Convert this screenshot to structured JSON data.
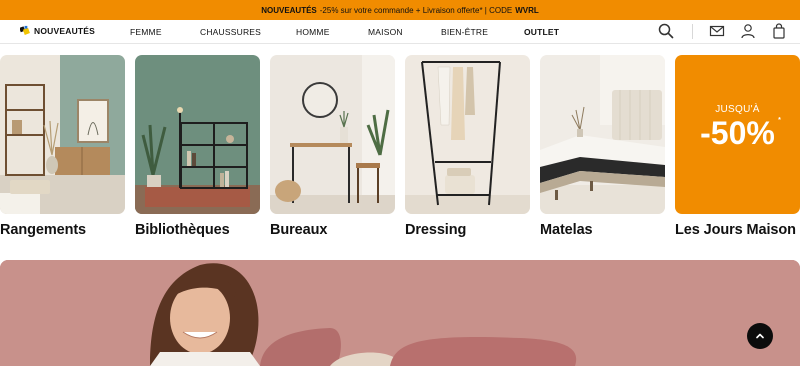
{
  "promo_bar": {
    "bold_text": "NOUVEAUTÉS",
    "text": "-25% sur votre commande + Livraison offerte* | CODE",
    "code": "WVRL"
  },
  "nav": {
    "items": [
      "NOUVEAUTÉS",
      "FEMME",
      "CHAUSSURES",
      "HOMME",
      "MAISON",
      "BIEN-ÊTRE",
      "OUTLET"
    ]
  },
  "icons": {
    "search": "search-icon",
    "mail": "mail-icon",
    "account": "user-icon",
    "cart": "bag-icon",
    "scroll_top": "chevron-up-icon"
  },
  "categories": [
    {
      "label": "Rangements"
    },
    {
      "label": "Bibliothèques"
    },
    {
      "label": "Bureaux"
    },
    {
      "label": "Dressing"
    },
    {
      "label": "Matelas"
    },
    {
      "label": "Les Jours Maison"
    }
  ],
  "promo_tile": {
    "small": "JUSQU'À",
    "big": "-50%",
    "mark": "*"
  },
  "colors": {
    "accent": "#f18c00",
    "hero_bg": "#c98c87"
  }
}
